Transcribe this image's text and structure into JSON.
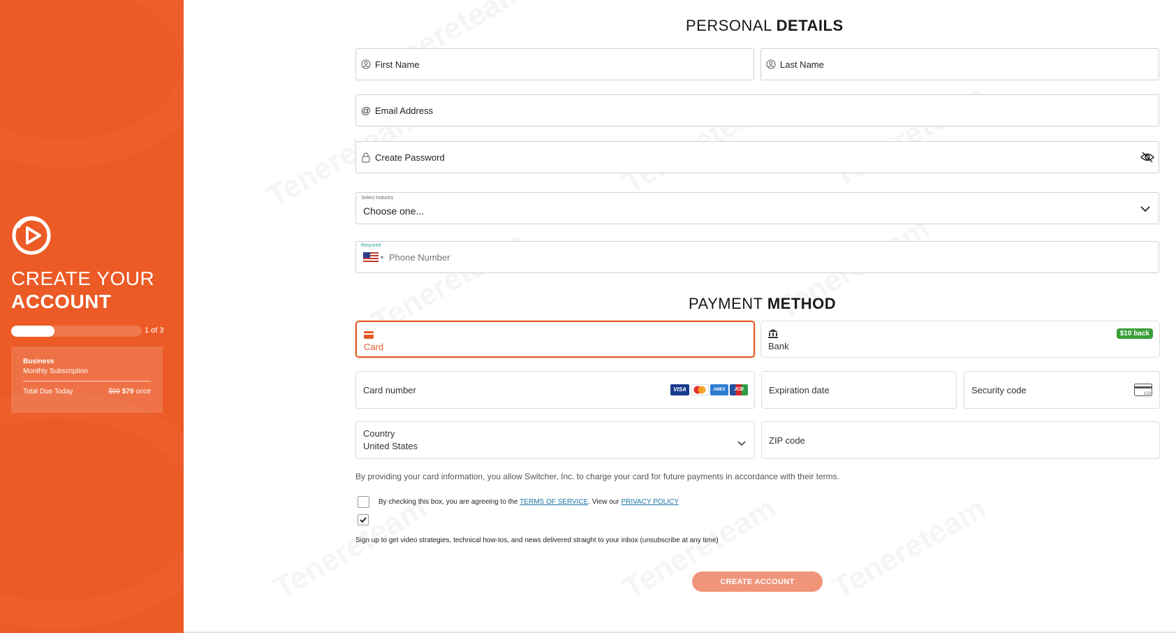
{
  "sidebar": {
    "title_line1": "CREATE YOUR",
    "title_line2": "ACCOUNT",
    "progress": {
      "current": 1,
      "total": 3,
      "fraction": 0.33,
      "text": "1 of 3"
    },
    "plan": {
      "name": "Business",
      "subtitle": "Monthly Subscription",
      "total_label": "Total Due Today",
      "old_price": "$99",
      "new_price": "$79",
      "suffix": "once"
    }
  },
  "watermark": {
    "text": "Tenereteam"
  },
  "personal": {
    "title_light": "PERSONAL",
    "title_bold": "DETAILS",
    "first_name_placeholder": "First Name",
    "last_name_placeholder": "Last Name",
    "email_placeholder": "Email Address",
    "password_placeholder": "Create Password",
    "industry": {
      "label": "Select Industry",
      "value": "Choose one..."
    },
    "phone": {
      "label": "Required",
      "placeholder": "Phone Number"
    }
  },
  "payment": {
    "title_light": "PAYMENT",
    "title_bold": "METHOD",
    "card_tab": "Card",
    "bank_tab": "Bank",
    "bank_badge": "$10 back",
    "card_number": "Card number",
    "brands": [
      "VISA",
      "MC",
      "AMEX",
      "JCB"
    ],
    "expiration": "Expiration date",
    "security": "Security code",
    "security_hint": "123",
    "country_label": "Country",
    "country_value": "United States",
    "zip": "ZIP code",
    "disclaimer": "By providing your card information, you allow Switcher, Inc. to charge your card for future payments in accordance with their terms."
  },
  "terms": {
    "prefix": "By checking this box, you are agreeing to the",
    "tos_link": "TERMS OF SERVICE",
    "middle": ". View our",
    "privacy_link": "PRIVACY POLICY",
    "checked": false
  },
  "newsletter": {
    "text": "Sign up to get video strategies, technical how-tos, and news delivered straight to your inbox (unsubscribe at any time)",
    "checked": true
  },
  "cta": {
    "label": "CREATE ACCOUNT"
  },
  "colors": {
    "brand": "#ec5a26",
    "cta": "#f0947a",
    "badge": "#3a9e3a",
    "link": "#1a73a8"
  }
}
